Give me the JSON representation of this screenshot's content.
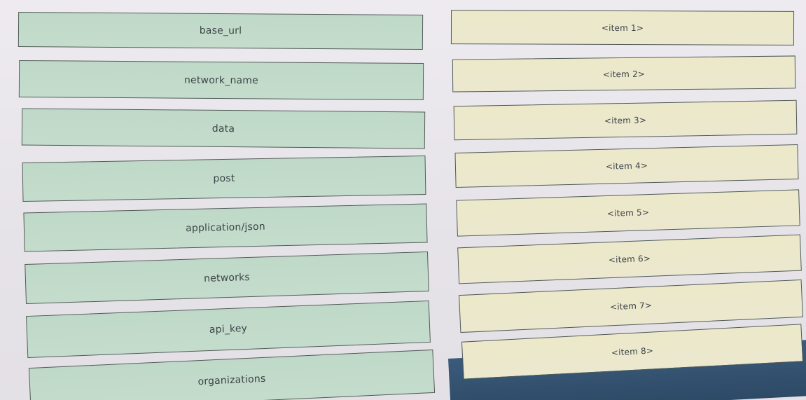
{
  "choices": [
    {
      "label": "base_url"
    },
    {
      "label": "network_name"
    },
    {
      "label": "data"
    },
    {
      "label": "post"
    },
    {
      "label": "application/json"
    },
    {
      "label": "networks"
    },
    {
      "label": "api_key"
    },
    {
      "label": "organizations"
    }
  ],
  "targets": [
    {
      "label": "<item 1>"
    },
    {
      "label": "<item 2>"
    },
    {
      "label": "<item 3>"
    },
    {
      "label": "<item 4>"
    },
    {
      "label": "<item 5>"
    },
    {
      "label": "<item 6>"
    },
    {
      "label": "<item 7>"
    },
    {
      "label": "<item 8>"
    }
  ],
  "colors": {
    "choice_bg": "#c2dbca",
    "target_bg": "#ece8cb",
    "border": "#4f5b56",
    "taskbar": "#34536f"
  }
}
